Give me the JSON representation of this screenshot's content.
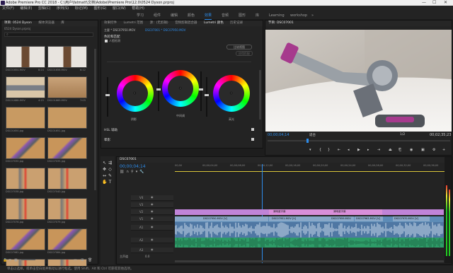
{
  "window": {
    "title": "Adobe Premiere Pro CC 2018 - C:\\用户\\fatmatt\\文档\\Adobe\\Premiere Pro\\12.0\\0524 Dyson.prproj",
    "min": "—",
    "max": "☐",
    "close": "✕"
  },
  "menu": [
    "文件(F)",
    "编辑(E)",
    "剪辑(C)",
    "序列(S)",
    "标记(M)",
    "图形(G)",
    "窗口(W)",
    "帮助(H)"
  ],
  "workspaces": {
    "items": [
      "学习",
      "组件",
      "编辑",
      "颜色",
      "效果",
      "音频",
      "图形",
      "库",
      "Learning",
      "workshop"
    ],
    "active": "效果",
    "more": "»"
  },
  "project": {
    "tabs": [
      "项目: 0524 Dyson",
      "媒体浏览器",
      "库",
      "信息",
      "效果",
      "标记"
    ],
    "name": "0524 Dyson.prproj",
    "search_placeholder": "",
    "clips": [
      {
        "name": "DSC01654.MOV",
        "dur": "8:24",
        "kind": "person"
      },
      {
        "name": "DSC01656.MOV",
        "dur": "6:12",
        "kind": "person"
      },
      {
        "name": "DSC01668.MOV",
        "dur": "4:15",
        "kind": "printer"
      },
      {
        "name": "DSC01669.MOV",
        "dur": "7:03",
        "kind": "box"
      },
      {
        "name": "DSC01650.jpg",
        "dur": "",
        "kind": "floor"
      },
      {
        "name": "DSC01651.jpg",
        "dur": "",
        "kind": "floor"
      },
      {
        "name": "DSC07030.jpg",
        "dur": "",
        "kind": "vacuum"
      },
      {
        "name": "DSC07035.jpg",
        "dur": "",
        "kind": "vacuum"
      },
      {
        "name": "DSC07038.jpg",
        "dur": "",
        "kind": "parts"
      },
      {
        "name": "DSC07040.jpg",
        "dur": "",
        "kind": "parts"
      },
      {
        "name": "DSC07076.jpg",
        "dur": "",
        "kind": "parts"
      },
      {
        "name": "DSC07079.jpg",
        "dur": "",
        "kind": "parts"
      },
      {
        "name": "DSC07082.jpg",
        "dur": "",
        "kind": "vacuum"
      },
      {
        "name": "DSC07084.jpg",
        "dur": "",
        "kind": "vacuum"
      },
      {
        "name": "DSC07093.jpg",
        "dur": "",
        "kind": "parts"
      },
      {
        "name": "DSC07095.jpg",
        "dur": "",
        "kind": "parts"
      }
    ]
  },
  "lumetri": {
    "tabs": [
      "效果控件",
      "Lumetri 范围",
      "源：(无剪辑)",
      "音频剪辑混合器",
      "Lumetri 颜色",
      "历史记录"
    ],
    "breadcrumb_left": "主要 * DSC07950.MOV",
    "breadcrumb_right": "DSC07001 * DSC07950.MOV",
    "section": "基本校正",
    "sub": "色轮和匹配",
    "compare_btn": "比较视图",
    "apply_btn": "应用匹配",
    "face_detect": "人脸检测",
    "wheels": [
      "阴影",
      "中间调",
      "高光"
    ],
    "hsl": "HSL 辅助",
    "vignette": "晕影"
  },
  "monitor": {
    "tab": "节目: DSC07001",
    "timecode": "00;00;04;14",
    "fit": "适合",
    "quality": "1/2",
    "duration": "00;02;35;23"
  },
  "timeline": {
    "tab": "DSC07001",
    "timecode": "00;00;04;14",
    "ruler": [
      "00;00",
      "00;00;04;00",
      "00;00;08;00",
      "00;00;12;00",
      "00;00;16;00",
      "00;00;20;00",
      "00;00;24;00",
      "00;00;28;00",
      "00;00;32;00",
      "00;00;36;00"
    ],
    "tracks_v": [
      "V4",
      "V3",
      "V2",
      "V1"
    ],
    "tracks_a": [
      "A1",
      "A2",
      "A3"
    ],
    "master": "主声道",
    "master_val": "0.0",
    "clip_labels": [
      "DSC07950.MOV [V]",
      "DSC07951.MOV [V]",
      "DSC07959.MOV",
      "DSC07963.MOV [V]",
      "DSC07970.MOV [V]"
    ],
    "title_labels": [
      "清晰度字幕",
      "清晰度字幕"
    ]
  },
  "status": "单击以选择，或单击空白处并拖动以进行框选。使用 Shift、Alt 和 Ctrl 可获得其他选项。"
}
